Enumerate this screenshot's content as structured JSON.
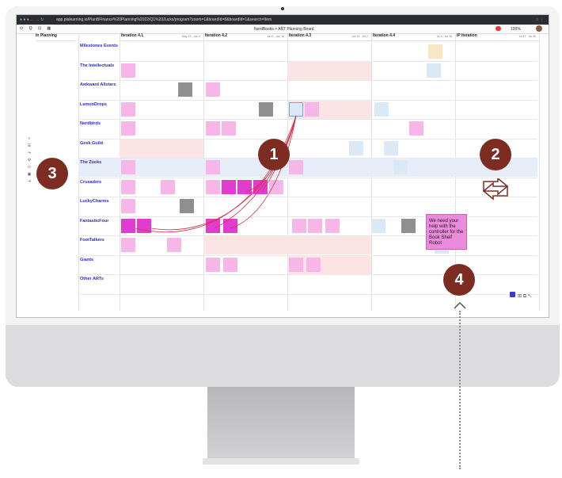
{
  "browser": {
    "url": "app.pialearning.io/PlanBFinance%20Planning%2022/Q1%20Zucks/program?zoom=1&boardId=8&boardId=1&search=Item"
  },
  "toolbar": {
    "breadcrumb": "NerdBooks > ART Planning Board",
    "zoom": "100%"
  },
  "board": {
    "planning_label": "In Planning",
    "iterations": [
      {
        "name": "Iteration 4.1",
        "dates": "May 23 - Jun 4"
      },
      {
        "name": "Iteration 4.2",
        "dates": "Jun 5 - Jun 18"
      },
      {
        "name": "Iteration 4.3",
        "dates": "Jun 19 - Jul 2"
      },
      {
        "name": "Iteration 4.4",
        "dates": "Jul 3 - Jul 16"
      },
      {
        "name": "IP Iteration",
        "dates": "Jul 17 - Jul 30"
      }
    ],
    "teams": [
      "Milestones Events",
      "The Intellectuals",
      "Awkward Allstars",
      "LemonDrops",
      "Nerdbirds",
      "Geek Guild",
      "The Zucks",
      "Crusaders",
      "LuckyCharms",
      "FantasticFour",
      "FootTalkers",
      "Giants",
      "Other ARTs"
    ],
    "featured_card": {
      "text": "We need your help with the controller for the Book Shelf Robot"
    },
    "colors": {
      "accent": "#7d2c22",
      "team_link": "#2b2bd9",
      "sticky_pink": "#f7b6e8",
      "sticky_magenta": "#e23ccf",
      "dependency_red": "#d9304a"
    }
  },
  "callouts": {
    "c1": "1",
    "c2": "2",
    "c3": "3",
    "c4": "4"
  }
}
